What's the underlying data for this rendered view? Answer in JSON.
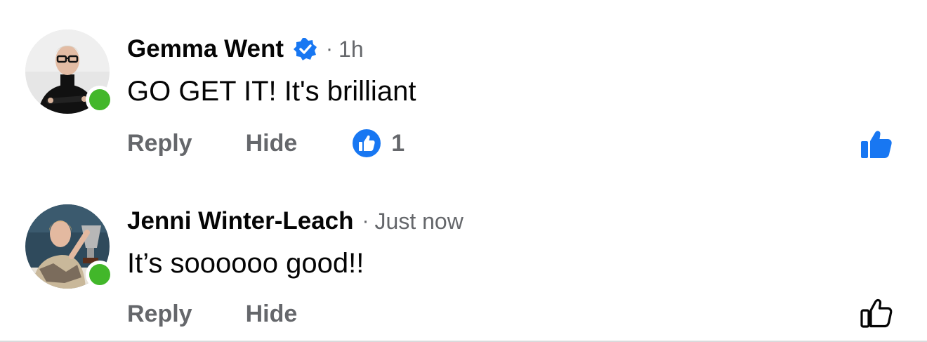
{
  "comments": [
    {
      "author": "Gemma Went",
      "verified": true,
      "separator": "·",
      "time": "1h",
      "text": "GO GET IT! It's brilliant",
      "reply_label": "Reply",
      "hide_label": "Hide",
      "reaction_count": "1",
      "liked": true,
      "online": true
    },
    {
      "author": "Jenni Winter-Leach",
      "verified": false,
      "separator": "·",
      "time": "Just now",
      "text": "It’s soooooo good!!",
      "reply_label": "Reply",
      "hide_label": "Hide",
      "liked": false,
      "online": true
    }
  ],
  "colors": {
    "brand_blue": "#1877f2",
    "online_green": "#42b72a",
    "secondary_text": "#65676b",
    "primary_text": "#050505"
  },
  "icons": {
    "verified": "verified-badge-icon",
    "reaction": "like-reaction-icon",
    "like_filled": "thumbs-up-filled-icon",
    "like_outline": "thumbs-up-outline-icon"
  }
}
